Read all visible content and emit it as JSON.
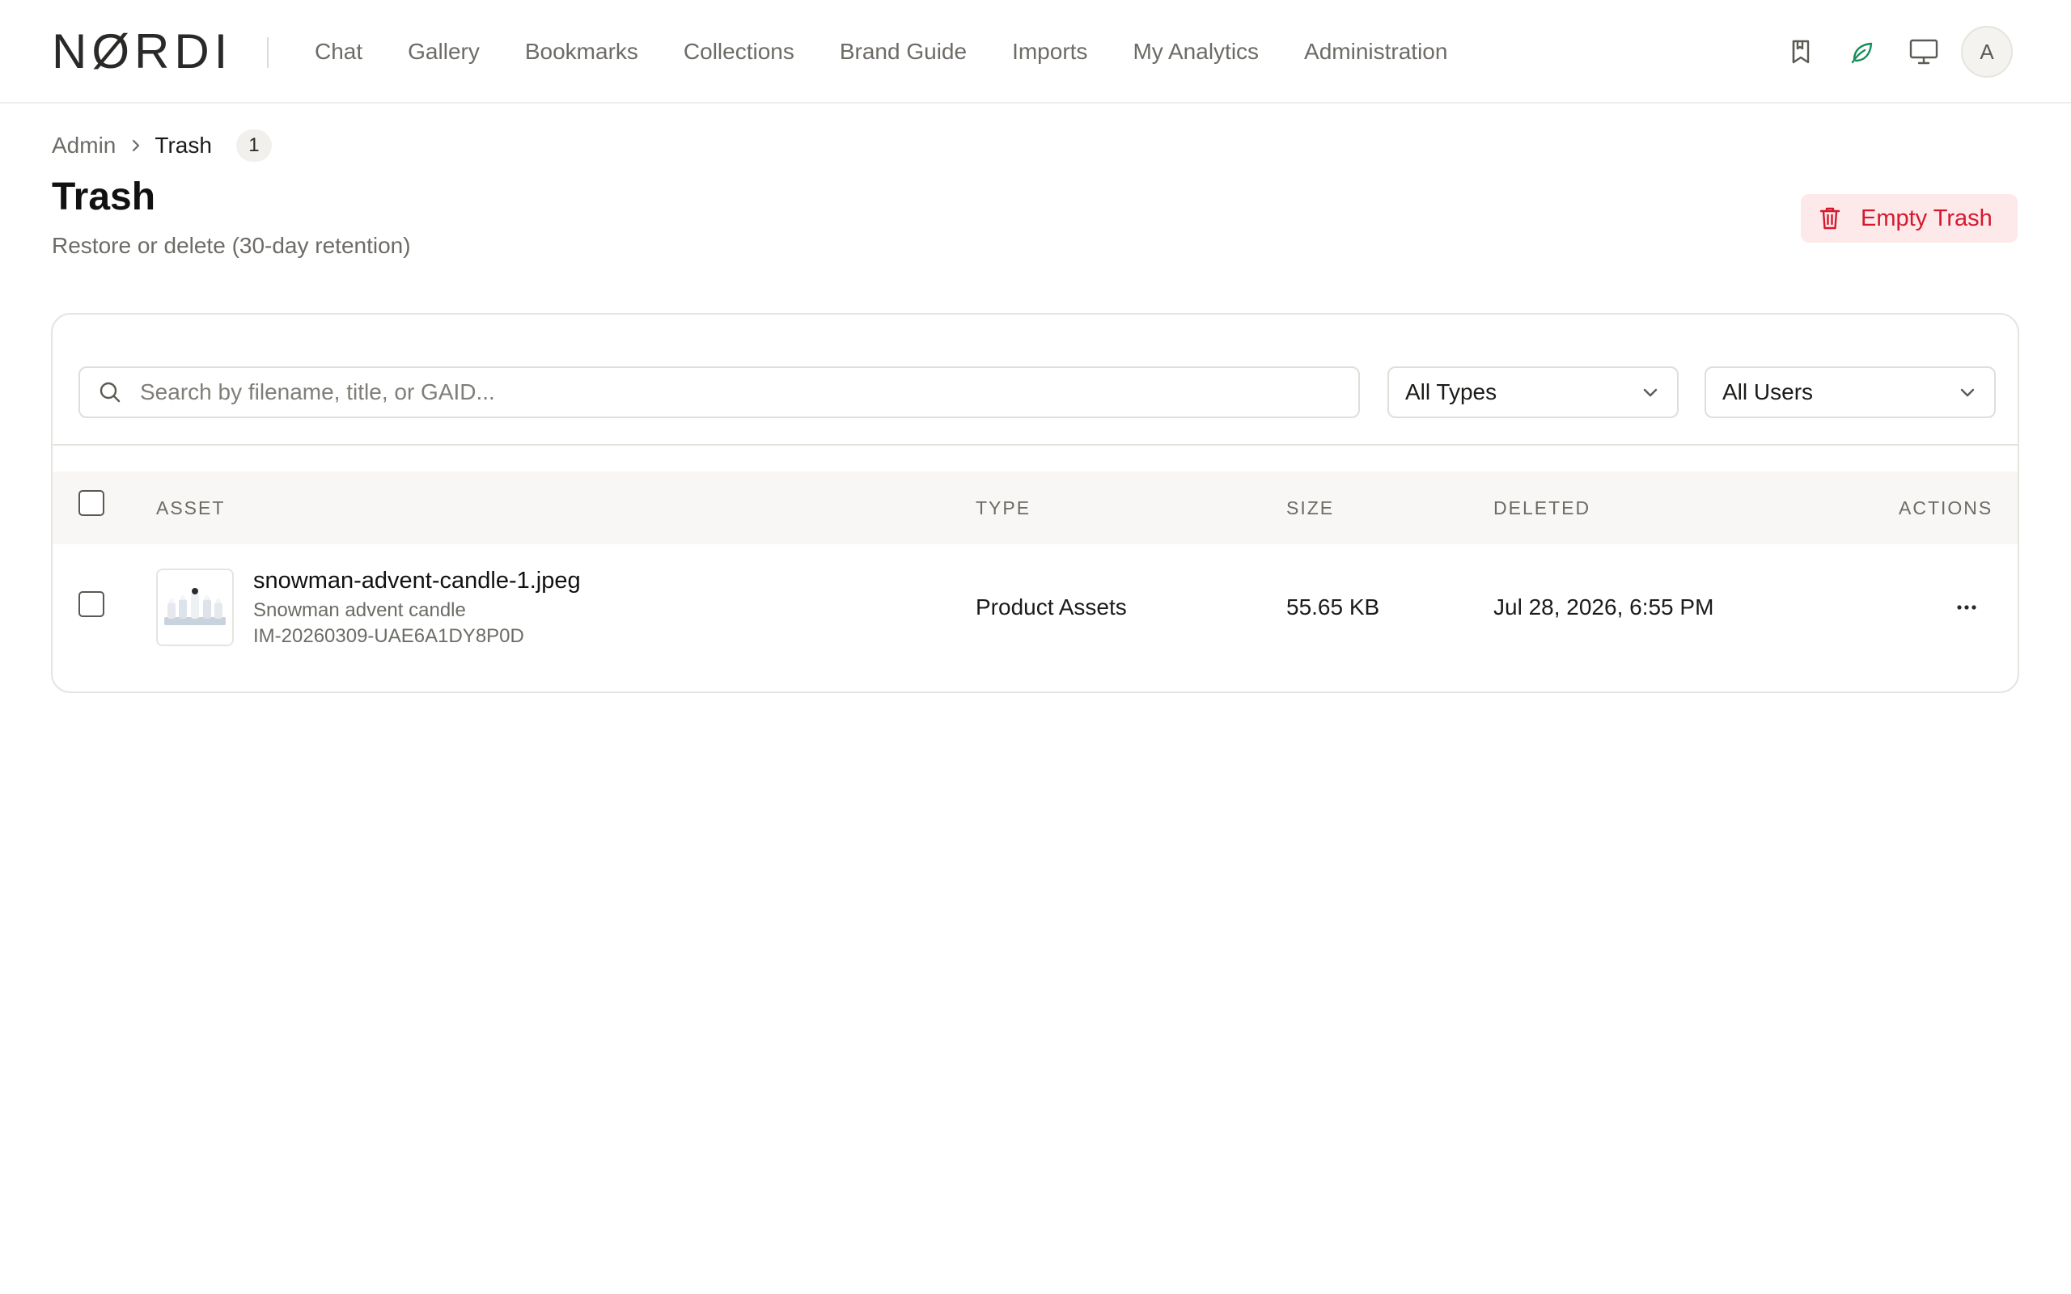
{
  "app": {
    "logo": "NØRDI"
  },
  "nav": {
    "items": [
      {
        "label": "Chat"
      },
      {
        "label": "Gallery"
      },
      {
        "label": "Bookmarks"
      },
      {
        "label": "Collections"
      },
      {
        "label": "Brand Guide"
      },
      {
        "label": "Imports"
      },
      {
        "label": "My Analytics"
      },
      {
        "label": "Administration"
      }
    ]
  },
  "header_icons": {
    "bookmark": "bookmark-icon",
    "leaf": "leaf-icon",
    "monitor": "monitor-icon",
    "avatar_initial": "A",
    "leaf_color": "#1a8c5b"
  },
  "breadcrumb": {
    "parent": "Admin",
    "current": "Trash",
    "count": "1"
  },
  "page": {
    "title": "Trash",
    "subtitle": "Restore or delete (30-day retention)"
  },
  "empty_trash": {
    "label": "Empty Trash",
    "color": "#d6192d",
    "background": "#fde8ea"
  },
  "filters": {
    "search_placeholder": "Search by filename, title, or GAID...",
    "type_selected": "All Types",
    "user_selected": "All Users"
  },
  "table": {
    "columns": {
      "asset": "ASSET",
      "type": "TYPE",
      "size": "SIZE",
      "deleted": "DELETED",
      "actions": "ACTIONS"
    },
    "rows": [
      {
        "filename": "snowman-advent-candle-1.jpeg",
        "title": "Snowman advent candle",
        "gaid": "IM-20260309-UAE6A1DY8P0D",
        "type": "Product Assets",
        "size": "55.65 KB",
        "deleted": "Jul 28, 2026, 6:55 PM",
        "actions_icon": "more-horizontal-icon"
      }
    ]
  }
}
